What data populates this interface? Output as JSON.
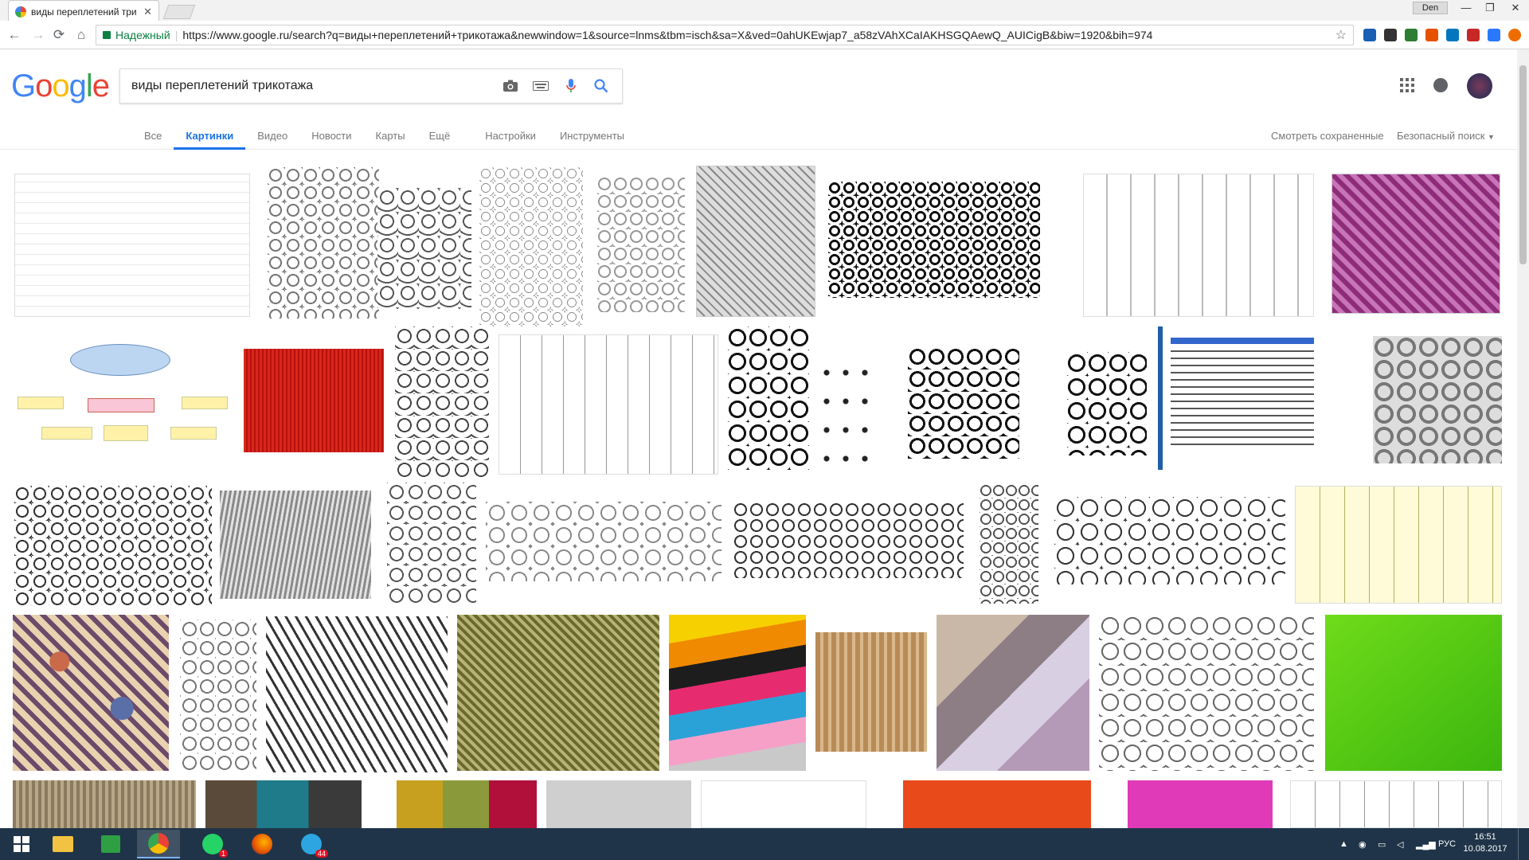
{
  "browser": {
    "tab_title": "виды переплетений три",
    "user_badge": "Den",
    "secure_label": "Надежный",
    "url": "https://www.google.ru/search?q=виды+переплетений+трикотажа&newwindow=1&source=lnms&tbm=isch&sa=X&ved=0ahUKEwjap7_a58zVAhXCaIAKHSGQAewQ_AUICigB&biw=1920&bih=974"
  },
  "search": {
    "logo": "Google",
    "query": "виды переплетений трикотажа"
  },
  "tabs": [
    {
      "label": "Все"
    },
    {
      "label": "Картинки"
    },
    {
      "label": "Видео"
    },
    {
      "label": "Новости"
    },
    {
      "label": "Карты"
    },
    {
      "label": "Ещё"
    },
    {
      "label": "Настройки"
    },
    {
      "label": "Инструменты"
    }
  ],
  "right_links": {
    "saved": "Смотреть сохраненные",
    "safe_search": "Безопасный поиск"
  },
  "taskbar": {
    "lang": "РУС",
    "time": "16:51",
    "date": "10.08.2017",
    "whatsapp_badge": "1",
    "telegram_badge": "44"
  },
  "colors": {
    "accent": "#1a73e8",
    "taskbar": "#1f3448"
  }
}
